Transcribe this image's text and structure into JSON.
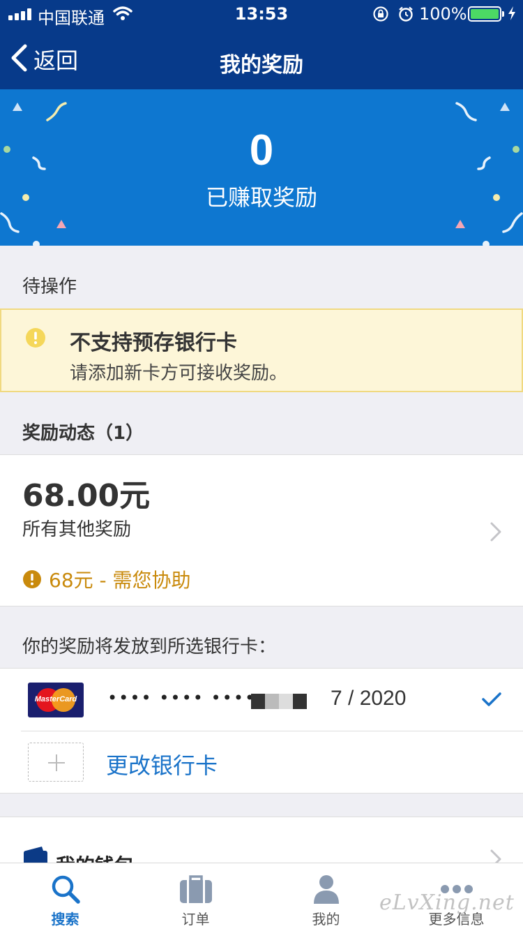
{
  "status_bar": {
    "carrier": "中国联通",
    "time": "13:53",
    "battery": "100%"
  },
  "nav": {
    "back_label": "返回",
    "title": "我的奖励"
  },
  "hero": {
    "value": "0",
    "label": "已赚取奖励"
  },
  "pending": {
    "heading": "待操作",
    "warning_title": "不支持预存银行卡",
    "warning_text": "请添加新卡方可接收奖励。"
  },
  "activity": {
    "heading": "奖励动态（1）",
    "amount": "68.00元",
    "description": "所有其他奖励",
    "status": "68元 - 需您协助"
  },
  "payout": {
    "heading": "你的奖励将发放到所选银行卡：",
    "card_brand": "MasterCard",
    "card_number": "•••• •••• ••••",
    "card_expiry": "7 / 2020",
    "change_label": "更改银行卡"
  },
  "wallet": {
    "label": "我的钱包"
  },
  "tabs": [
    {
      "label": "搜索",
      "icon": "search-icon",
      "active": true
    },
    {
      "label": "订单",
      "icon": "briefcase-icon",
      "active": false
    },
    {
      "label": "我的",
      "icon": "person-icon",
      "active": false
    },
    {
      "label": "更多信息",
      "icon": "more-icon",
      "active": false
    }
  ],
  "watermark": "eLvXing.net",
  "colors": {
    "nav_bg": "#073a8a",
    "hero_bg": "#0e77d0",
    "accent": "#1a73c9",
    "warning": "#c98a0c"
  }
}
